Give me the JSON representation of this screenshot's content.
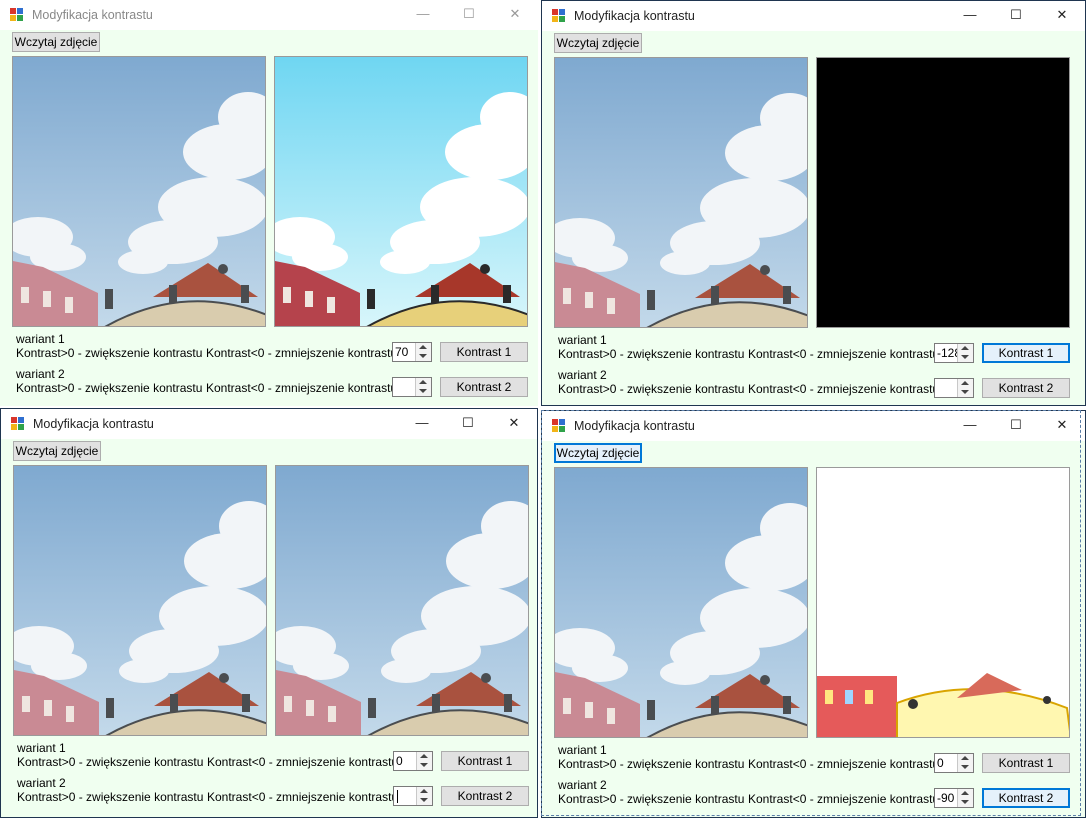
{
  "windows": [
    {
      "title": "Modyfikacja kontrastu",
      "load_button": "Wczytaj zdjęcie",
      "variant1": "wariant 1",
      "variant2": "wariant 2",
      "inc_label": "Kontrast>0 - zwiększenie kontrastu",
      "dec_label": "Kontrast<0 - zmniejszenie kontrastu",
      "value1": "70",
      "value2": "",
      "button1": "Kontrast 1",
      "button2": "Kontrast 2",
      "result": "high-contrast"
    },
    {
      "title": "Modyfikacja kontrastu",
      "load_button": "Wczytaj zdjęcie",
      "variant1": "wariant 1",
      "variant2": "wariant 2",
      "inc_label": "Kontrast>0 - zwiększenie kontrastu",
      "dec_label": "Kontrast<0 - zmniejszenie kontrastu",
      "value1": "-128",
      "value2": "",
      "button1": "Kontrast 1",
      "button2": "Kontrast 2",
      "result": "black"
    },
    {
      "title": "Modyfikacja kontrastu",
      "load_button": "Wczytaj zdjęcie",
      "variant1": "wariant 1",
      "variant2": "wariant 2",
      "inc_label": "Kontrast>0 - zwiększenie kontrastu",
      "dec_label": "Kontrast<0 - zmniejszenie kontrastu",
      "value1": "0",
      "value2": "",
      "button1": "Kontrast 1",
      "button2": "Kontrast 2",
      "result": "same"
    },
    {
      "title": "Modyfikacja kontrastu",
      "load_button": "Wczytaj zdjęcie",
      "variant1": "wariant 1",
      "variant2": "wariant 2",
      "inc_label": "Kontrast>0 - zwiększenie kontrastu",
      "dec_label": "Kontrast<0 - zmniejszenie kontrastu",
      "value1": "0",
      "value2": "-90",
      "button1": "Kontrast 1",
      "button2": "Kontrast 2",
      "result": "white"
    }
  ],
  "colors": {
    "form_bg": "#f0fff0",
    "sky": "#8fb6d8",
    "sky_hc": "#7fd8ee",
    "roof": "#b0503a",
    "wall_pink": "#c98a94"
  }
}
